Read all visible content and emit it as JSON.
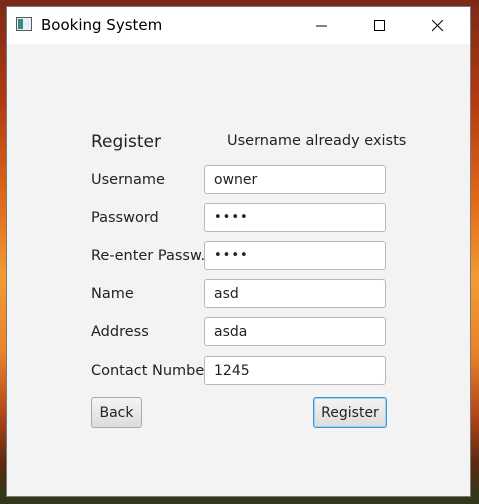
{
  "window": {
    "title": "Booking System"
  },
  "form": {
    "heading": "Register",
    "message": "Username already exists",
    "fields": {
      "username": {
        "label": "Username",
        "value": "owner"
      },
      "password": {
        "label": "Password",
        "value": "asda"
      },
      "reenter_password": {
        "label": "Re-enter Passw...",
        "value": "asda"
      },
      "name": {
        "label": "Name",
        "value": "asd"
      },
      "address": {
        "label": "Address",
        "value": "asda"
      },
      "contact": {
        "label": "Contact Number",
        "value": "1245"
      }
    },
    "back_label": "Back",
    "register_label": "Register"
  }
}
